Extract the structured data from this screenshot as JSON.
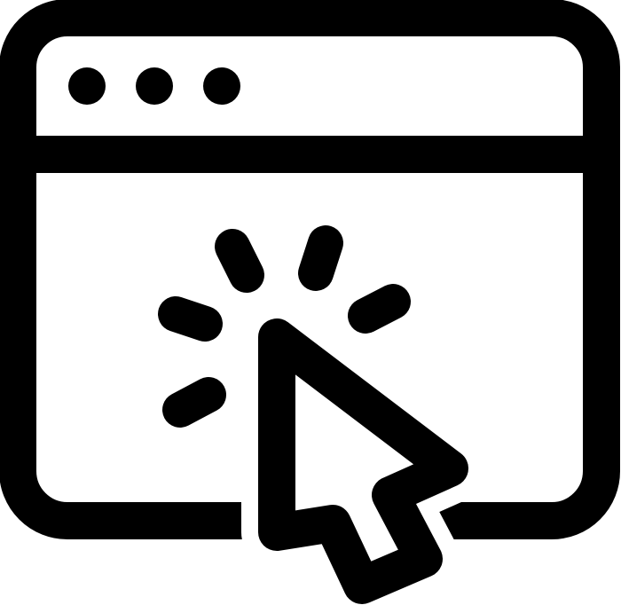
{
  "icon": {
    "name": "browser-click-icon",
    "parts": [
      "browser-window-icon",
      "window-dots-icon",
      "cursor-arrow-icon",
      "click-burst-icon"
    ]
  },
  "colors": {
    "stroke": "#000000",
    "fill": "#ffffff",
    "background": "#ffffff"
  }
}
